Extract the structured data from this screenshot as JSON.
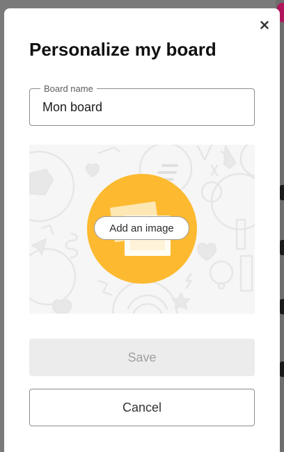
{
  "modal": {
    "title": "Personalize my board",
    "board_name": {
      "label": "Board name",
      "value": "Mon board"
    },
    "image_picker": {
      "button_label": "Add an image",
      "accent_color": "#fdba30"
    },
    "save_label": "Save",
    "save_disabled": true,
    "cancel_label": "Cancel"
  },
  "icons": {
    "close": "close-icon",
    "image": "image-stack-icon"
  }
}
